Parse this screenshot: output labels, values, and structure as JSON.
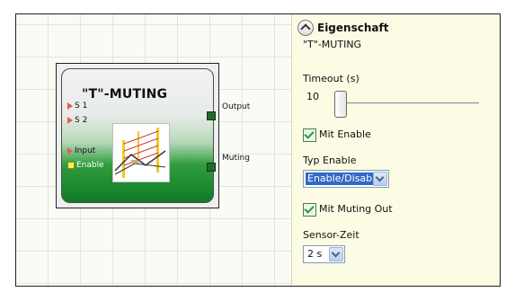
{
  "block": {
    "title": "\"T\"-MUTING",
    "inputs": [
      "S 1",
      "S 2",
      "Input",
      "Enable"
    ],
    "outputs": [
      "Output",
      "Muting"
    ]
  },
  "properties": {
    "header": "Eigenschaft",
    "subtitle": "\"T\"-MUTING",
    "timeout_label": "Timeout (s)",
    "timeout_value": "10",
    "mit_enable_label": "Mit Enable",
    "mit_enable_checked": true,
    "typ_enable_label": "Typ Enable",
    "typ_enable_value": "Enable/Disable",
    "mit_muting_out_label": "Mit Muting Out",
    "mit_muting_out_checked": true,
    "sensor_zeit_label": "Sensor-Zeit",
    "sensor_zeit_value": "2 s"
  }
}
